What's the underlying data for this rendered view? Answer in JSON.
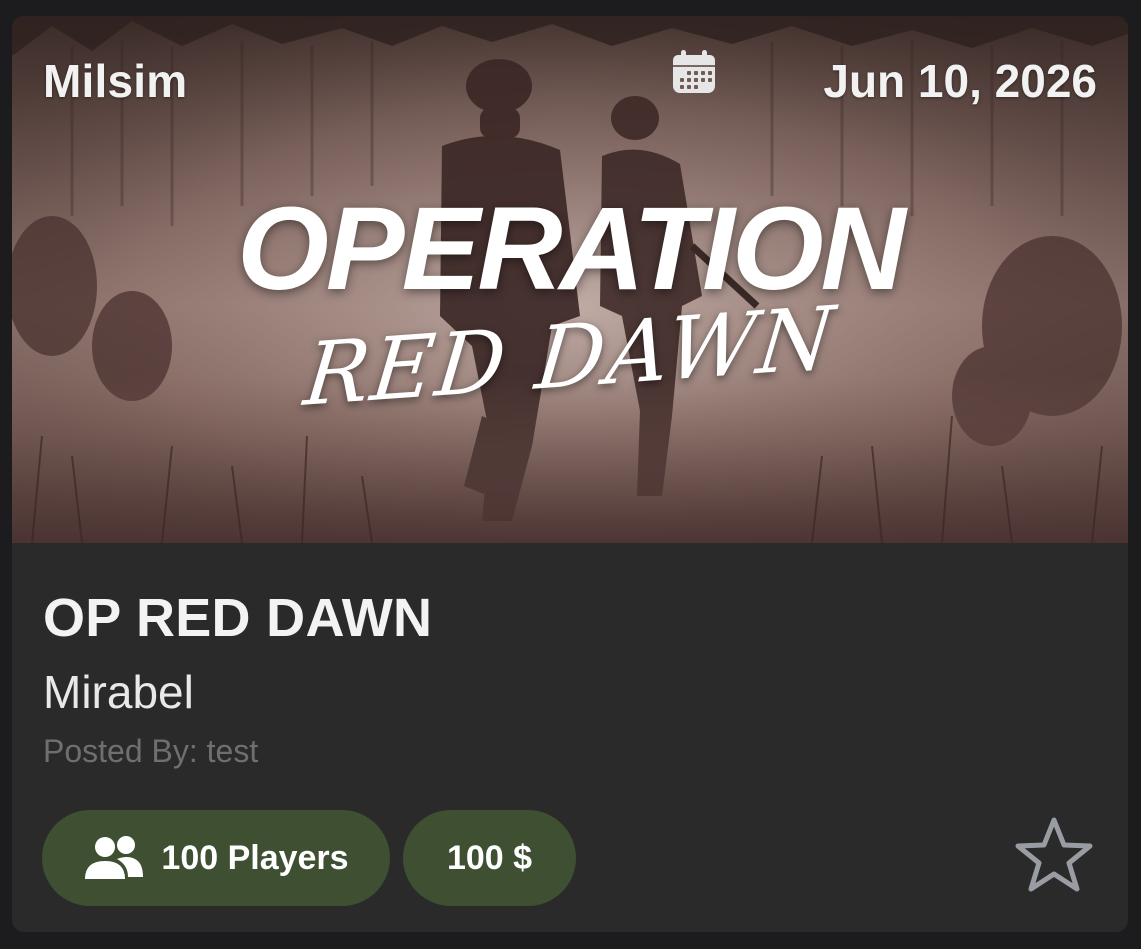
{
  "event": {
    "category": "Milsim",
    "date": "Jun 10, 2026",
    "banner": {
      "title": "OPERATION",
      "subtitle": "RED DAWN"
    },
    "name": "OP RED DAWN",
    "location": "Mirabel",
    "posted_by": "Posted By: test",
    "players_label": "100 Players",
    "price_label": "100 $"
  },
  "icons": {
    "calendar": "calendar-icon",
    "players": "users-icon",
    "favorite": "star-outline-icon"
  },
  "colors": {
    "card_background": "#2a2a2b",
    "page_background": "#1c1c1e",
    "pill_background": "#3e4f32",
    "secondary_text": "#6f6f72"
  }
}
